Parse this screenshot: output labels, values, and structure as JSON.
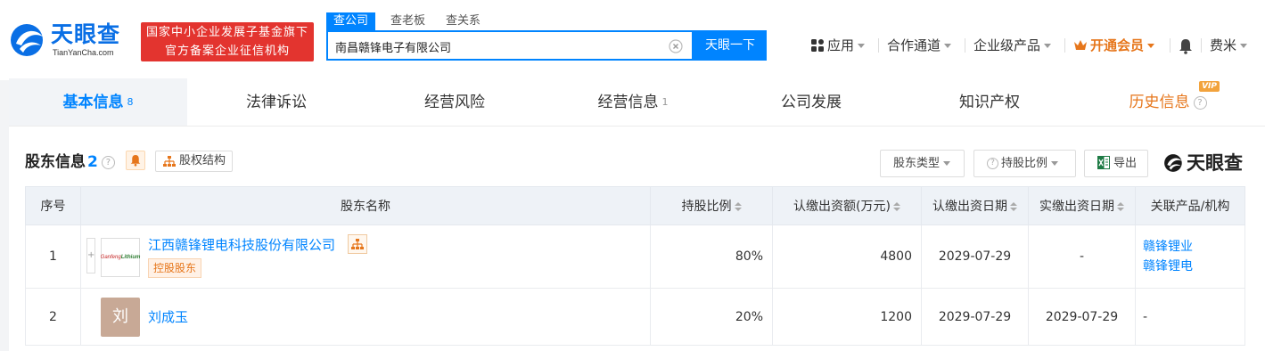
{
  "header": {
    "logo_name": "天眼查",
    "logo_sub": "TianYanCha.com",
    "slogan_line1": "国家中小企业发展子基金旗下",
    "slogan_line2": "官方备案企业征信机构",
    "search_tabs": [
      "查公司",
      "查老板",
      "查关系"
    ],
    "search_value": "南昌赣锋电子有限公司",
    "search_button": "天眼一下",
    "nav": {
      "apps": "应用",
      "cooperation": "合作通道",
      "enterprise": "企业级产品",
      "vip": "开通会员",
      "user": "费米"
    }
  },
  "tabs": [
    {
      "label": "基本信息",
      "count": "8"
    },
    {
      "label": "法律诉讼"
    },
    {
      "label": "经营风险"
    },
    {
      "label": "经营信息",
      "count": "1"
    },
    {
      "label": "公司发展"
    },
    {
      "label": "知识产权"
    },
    {
      "label": "历史信息",
      "badge": "VIP"
    }
  ],
  "section": {
    "title": "股东信息",
    "count": "2",
    "equity_structure": "股权结构",
    "filters": {
      "holder_type": "股东类型",
      "holding_ratio": "持股比例",
      "export": "导出"
    },
    "brand": "天眼查"
  },
  "table": {
    "headers": [
      "序号",
      "股东名称",
      "持股比例",
      "认缴出资额(万元)",
      "认缴出资日期",
      "实缴出资日期",
      "关联产品/机构"
    ],
    "rows": [
      {
        "index": "1",
        "name": "江西赣锋锂电科技股份有限公司",
        "tag": "控股股东",
        "logo_text_a": "Ganfeng",
        "logo_text_b": "Lithium",
        "ratio": "80%",
        "subscribed": "4800",
        "sub_date": "2029-07-29",
        "paid_date": "-",
        "related": [
          "赣锋锂业",
          "赣锋锂电"
        ]
      },
      {
        "index": "2",
        "name": "刘成玉",
        "avatar": "刘",
        "ratio": "20%",
        "subscribed": "1200",
        "sub_date": "2029-07-29",
        "paid_date": "2029-07-29",
        "related_text": "-"
      }
    ]
  },
  "colors": {
    "brand_blue": "#0084ff",
    "slogan_red": "#e3342f",
    "vip_orange": "#e6761b"
  }
}
